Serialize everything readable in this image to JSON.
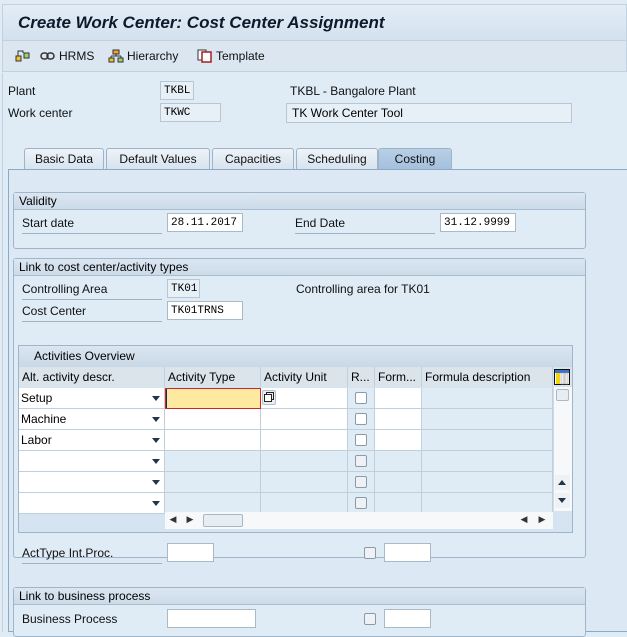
{
  "window": {
    "title": "Create Work Center: Cost Center Assignment"
  },
  "toolbar": {
    "items": [
      {
        "icon": "org-structure-icon",
        "label": ""
      },
      {
        "icon": "link-icon",
        "label": "HRMS"
      },
      {
        "icon": "hierarchy-icon",
        "label": "Hierarchy"
      },
      {
        "icon": "template-icon",
        "label": "Template"
      }
    ]
  },
  "header": {
    "plant_label": "Plant",
    "plant_value": "TKBL",
    "plant_desc": "TKBL - Bangalore Plant",
    "workcenter_label": "Work center",
    "workcenter_value": "TKWC",
    "workcenter_desc": "TK Work Center Tool"
  },
  "tabs": [
    {
      "label": "Basic Data",
      "active": false
    },
    {
      "label": "Default Values",
      "active": false
    },
    {
      "label": "Capacities",
      "active": false
    },
    {
      "label": "Scheduling",
      "active": false
    },
    {
      "label": "Costing",
      "active": true
    }
  ],
  "validity": {
    "title": "Validity",
    "start_label": "Start date",
    "start_value": "28.11.2017",
    "end_label": "End Date",
    "end_value": "31.12.9999"
  },
  "link_cc": {
    "title": "Link to cost center/activity types",
    "ca_label": "Controlling Area",
    "ca_value": "TK01",
    "ca_desc": "Controlling area for TK01",
    "cc_label": "Cost Center",
    "cc_value": "TK01TRNS"
  },
  "activities": {
    "title": "Activities Overview",
    "columns": [
      "Alt. activity descr.",
      "Activity Type",
      "Activity Unit",
      "R...",
      "Form...",
      "Formula description"
    ],
    "rows": [
      {
        "alt": "Setup",
        "type": "",
        "unit": "",
        "r": false,
        "form": "",
        "fdesc": ""
      },
      {
        "alt": "Machine",
        "type": "",
        "unit": "",
        "r": false,
        "form": "",
        "fdesc": ""
      },
      {
        "alt": "Labor",
        "type": "",
        "unit": "",
        "r": false,
        "form": "",
        "fdesc": ""
      },
      {
        "alt": "",
        "type": "",
        "unit": "",
        "r": false,
        "form": "",
        "fdesc": ""
      },
      {
        "alt": "",
        "type": "",
        "unit": "",
        "r": false,
        "form": "",
        "fdesc": ""
      },
      {
        "alt": "",
        "type": "",
        "unit": "",
        "r": false,
        "form": "",
        "fdesc": ""
      }
    ]
  },
  "acttype": {
    "label": "ActType Int.Proc.",
    "value": "",
    "value2": ""
  },
  "link_bp": {
    "title": "Link to business process",
    "bp_label": "Business Process",
    "bp_value": "",
    "bp_value2": ""
  }
}
